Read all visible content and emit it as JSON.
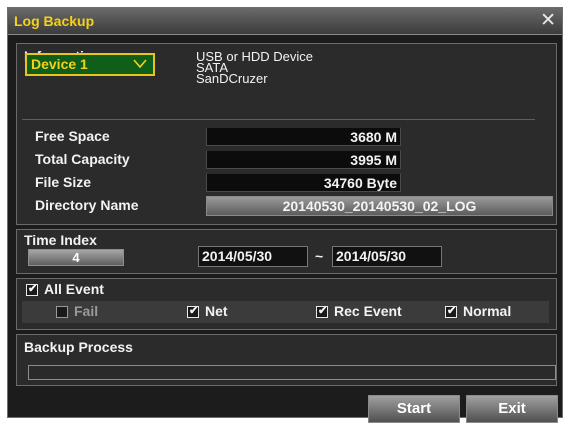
{
  "window": {
    "title": "Log Backup"
  },
  "information": {
    "label": "Information",
    "device_select": "Device 1",
    "device_info": [
      "USB or HDD Device",
      "SATA",
      "SanDCruzer"
    ],
    "rows": [
      {
        "label": "Free Space",
        "value": "3680 M"
      },
      {
        "label": "Total Capacity",
        "value": "3995 M"
      },
      {
        "label": "File Size",
        "value": "34760 Byte"
      }
    ],
    "directory_label": "Directory Name",
    "directory_value": "20140530_20140530_02_LOG"
  },
  "time_index": {
    "label": "Time Index",
    "button_value": "4",
    "start_date": "2014/05/30",
    "separator": "~",
    "end_date": "2014/05/30"
  },
  "events": {
    "all": {
      "label": "All Event",
      "checked": true
    },
    "items": [
      {
        "label": "Fail",
        "checked": false,
        "disabled": true
      },
      {
        "label": "Net",
        "checked": true
      },
      {
        "label": "Rec Event",
        "checked": true
      },
      {
        "label": "Normal",
        "checked": true
      }
    ]
  },
  "backup": {
    "label": "Backup Process",
    "progress": 0
  },
  "buttons": {
    "start": "Start",
    "exit": "Exit"
  },
  "colors": {
    "title": "#f5d21a",
    "device_bg": "#0f5e1a",
    "device_border": "#e7c51c"
  }
}
